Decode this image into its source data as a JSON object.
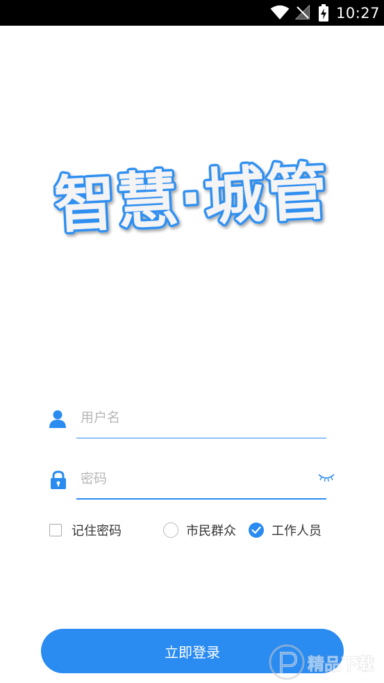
{
  "status_bar": {
    "time": "10:27",
    "icons": [
      "wifi-icon",
      "no-signal-icon",
      "battery-charging-icon"
    ]
  },
  "logo": {
    "text": "智慧·城管"
  },
  "login_form": {
    "username_placeholder": "用户名",
    "username_icon": "person-icon",
    "password_placeholder": "密码",
    "password_icon": "lock-icon",
    "password_toggle_icon": "eye-closed-icon"
  },
  "options": {
    "remember_password": {
      "label": "记住密码",
      "checked": false
    },
    "user_type": [
      {
        "label": "市民群众",
        "selected": false
      },
      {
        "label": "工作人员",
        "selected": true
      }
    ]
  },
  "login_button": {
    "label": "立即登录"
  },
  "watermark": {
    "text": "精品下载"
  },
  "colors": {
    "accent": "#2a8bf0",
    "logo_outline": "#2e8ff0",
    "placeholder": "#b7b7b7",
    "text": "#333333"
  }
}
